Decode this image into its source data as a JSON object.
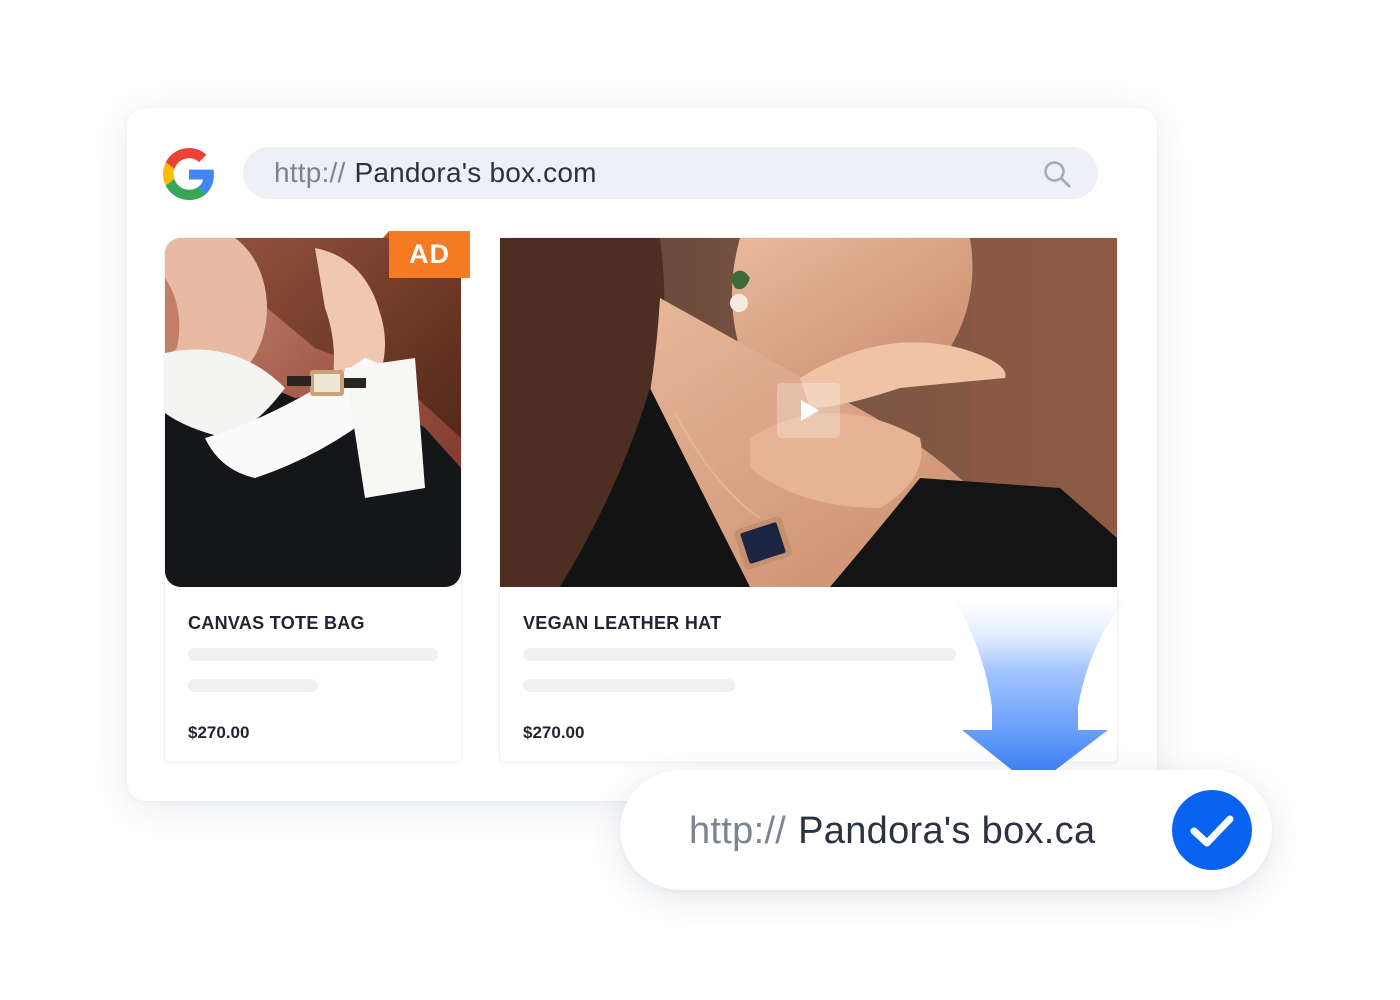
{
  "search": {
    "protocol": "http://",
    "domain": "Pandora's box.com"
  },
  "products": [
    {
      "title": "CANVAS TOTE BAG",
      "price": "$270.00",
      "badge": "AD"
    },
    {
      "title": "VEGAN LEATHER HAT",
      "price": "$270.00"
    }
  ],
  "result": {
    "protocol": "http://",
    "domain": "Pandora's box.ca"
  },
  "colors": {
    "accent_blue": "#0a63f0",
    "ad_orange": "#f47b24",
    "search_bg": "#edf0f4"
  },
  "icons": [
    "google-logo-icon",
    "search-icon",
    "play-icon",
    "down-arrow-icon",
    "checkmark-icon"
  ]
}
